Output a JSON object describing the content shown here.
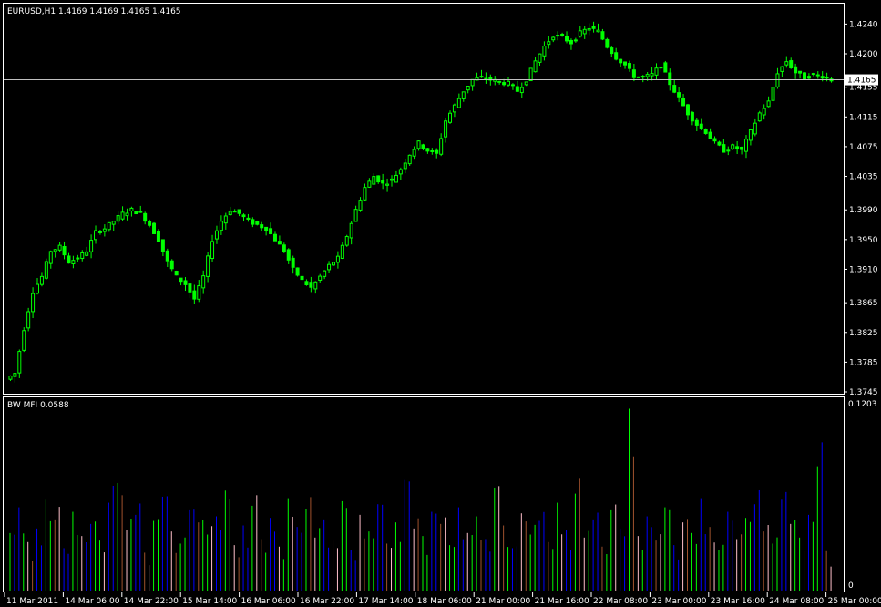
{
  "main_panel": {
    "header": "EURUSD,H1  1.4169 1.4169 1.4165 1.4165",
    "price_label": "1.4165",
    "y_ticks": [
      "1.4240",
      "1.4200",
      "1.4155",
      "1.4115",
      "1.4075",
      "1.4035",
      "1.3990",
      "1.3950",
      "1.3910",
      "1.3865",
      "1.3825",
      "1.3785",
      "1.3745"
    ]
  },
  "indicator_panel": {
    "header": "BW MFI 0.0588",
    "y_ticks": [
      "0.1203",
      "0"
    ]
  },
  "x_ticks": [
    "11 Mar 2011",
    "14 Mar 06:00",
    "14 Mar 22:00",
    "15 Mar 14:00",
    "16 Mar 06:00",
    "16 Mar 22:00",
    "17 Mar 14:00",
    "18 Mar 06:00",
    "21 Mar 00:00",
    "21 Mar 16:00",
    "22 Mar 08:00",
    "23 Mar 00:00",
    "23 Mar 16:00",
    "24 Mar 08:00",
    "25 Mar 00:00"
  ],
  "colors": {
    "background": "#000000",
    "candle": "#00ff00",
    "candle_body": "#000000",
    "frame": "#ffffff",
    "price_line": "#c0c0c0",
    "mfi_green": "#00ff00",
    "mfi_blue": "#0000ff",
    "mfi_pink": "#ffc0cb",
    "mfi_brown": "#a0522d"
  },
  "chart_data": [
    {
      "type": "line",
      "title": "EURUSD,H1",
      "subtitle": "1.4169 1.4169 1.4165 1.4165",
      "x_range": [
        "11 Mar 2011",
        "25 Mar 00:00"
      ],
      "ylim": [
        1.3745,
        1.4265
      ],
      "current_price": 1.4165,
      "series": [
        {
          "values": [
            1.377,
            1.383,
            1.388,
            1.39,
            1.3935,
            1.394,
            1.392,
            1.3925,
            1.3935,
            1.396,
            1.3965,
            1.3975,
            1.3985,
            1.399,
            1.3985,
            1.397,
            1.395,
            1.392,
            1.39,
            1.389,
            1.387,
            1.39,
            1.395,
            1.3975,
            1.399,
            1.3985,
            1.3975,
            1.397,
            1.3965,
            1.395,
            1.3935,
            1.391,
            1.3895,
            1.3885,
            1.39,
            1.3915,
            1.3925,
            1.3955,
            1.399,
            1.402,
            1.4035,
            1.4025,
            1.403,
            1.4045,
            1.4065,
            1.408,
            1.407,
            1.4065,
            1.411,
            1.413,
            1.415,
            1.4165,
            1.4168,
            1.4165,
            1.4162,
            1.416,
            1.415,
            1.4165,
            1.419,
            1.421,
            1.4225,
            1.4222,
            1.4215,
            1.4228,
            1.4235,
            1.423,
            1.421,
            1.4195,
            1.4185,
            1.417,
            1.4168,
            1.4172,
            1.4185,
            1.416,
            1.414,
            1.412,
            1.4105,
            1.4095,
            1.408,
            1.407,
            1.4075,
            1.407,
            1.4095,
            1.412,
            1.4135,
            1.4175,
            1.419,
            1.4175,
            1.4168,
            1.4172,
            1.417,
            1.4165
          ]
        }
      ]
    },
    {
      "type": "bar",
      "title": "BW MFI",
      "ylim": [
        0,
        0.1203
      ],
      "series": [
        {
          "values": [
            0.038,
            0.055,
            0.032,
            0.041,
            0.06,
            0.047,
            0.028,
            0.052,
            0.036,
            0.044,
            0.033,
            0.058,
            0.071,
            0.04,
            0.05,
            0.025,
            0.046,
            0.062,
            0.039,
            0.031,
            0.053,
            0.045,
            0.037,
            0.049,
            0.066,
            0.03,
            0.043,
            0.056,
            0.034,
            0.048,
            0.029,
            0.061,
            0.042,
            0.054,
            0.035,
            0.047,
            0.033,
            0.059,
            0.027,
            0.05,
            0.039,
            0.057,
            0.031,
            0.045,
            0.073,
            0.041,
            0.036,
            0.052,
            0.044,
            0.03,
            0.055,
            0.038,
            0.049,
            0.034,
            0.068,
            0.043,
            0.028,
            0.051,
            0.037,
            0.046,
            0.032,
            0.058,
            0.04,
            0.064,
            0.035,
            0.047,
            0.029,
            0.053,
            0.041,
            0.12,
            0.036,
            0.049,
            0.033,
            0.055,
            0.03,
            0.045,
            0.038,
            0.061,
            0.042,
            0.027,
            0.052,
            0.034,
            0.048,
            0.057,
            0.039,
            0.031,
            0.06,
            0.044,
            0.035,
            0.05,
            0.082,
            0.026
          ],
          "colors": [
            "g",
            "b",
            "p",
            "b",
            "g",
            "r",
            "b",
            "g",
            "p",
            "b",
            "g",
            "b",
            "g",
            "p",
            "b",
            "r",
            "g",
            "b",
            "p",
            "g",
            "b",
            "r",
            "g",
            "b",
            "g",
            "p",
            "b",
            "g",
            "r",
            "b",
            "p",
            "g",
            "b",
            "g",
            "p",
            "b",
            "r",
            "g",
            "b",
            "p",
            "g",
            "b",
            "r",
            "g",
            "b",
            "p",
            "g",
            "b",
            "r",
            "g",
            "b",
            "p",
            "g",
            "b",
            "g",
            "r",
            "b",
            "p",
            "g",
            "b",
            "r",
            "g",
            "b",
            "g",
            "p",
            "b",
            "r",
            "g",
            "b",
            "g",
            "p",
            "b",
            "r",
            "g",
            "b",
            "p",
            "g",
            "b",
            "r",
            "g",
            "b",
            "p",
            "g",
            "b",
            "r",
            "g",
            "b",
            "p",
            "g",
            "b",
            "g",
            "r"
          ]
        }
      ]
    }
  ]
}
